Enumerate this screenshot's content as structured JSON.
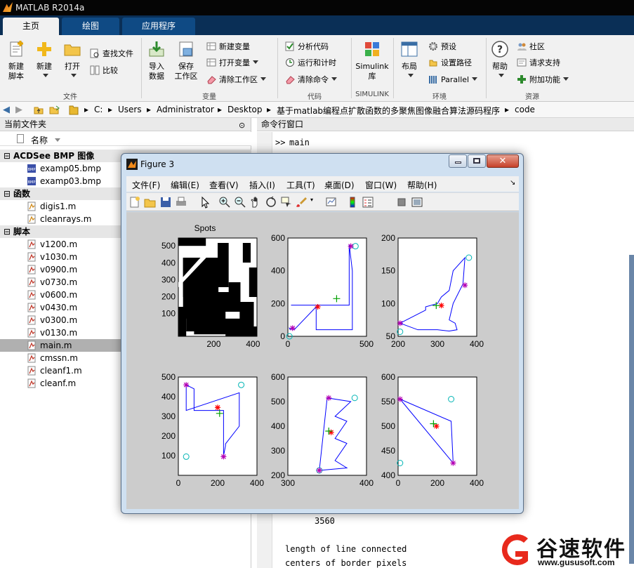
{
  "window": {
    "title": "MATLAB R2014a"
  },
  "tabs": [
    {
      "label": "主页"
    },
    {
      "label": "绘图"
    },
    {
      "label": "应用程序"
    }
  ],
  "ribbon": {
    "new_script": "新建\n脚本",
    "new": "新建",
    "open": "打开",
    "find_files": "查找文件",
    "compare": "比较",
    "group_file": "文件",
    "import": "导入\n数据",
    "save_ws": "保存\n工作区",
    "new_var": "新建变量",
    "open_var": "打开变量",
    "clear_ws": "清除工作区",
    "group_var": "变量",
    "analyze": "分析代码",
    "run_time": "运行和计时",
    "clear_cmd": "清除命令",
    "group_code": "代码",
    "simulink": "Simulink\n库",
    "group_simulink": "SIMULINK",
    "layout": "布局",
    "prefs": "预设",
    "set_path": "设置路径",
    "parallel": "Parallel",
    "group_env": "环境",
    "help": "帮助",
    "community": "社区",
    "support": "请求支持",
    "addons": "附加功能",
    "group_res": "资源"
  },
  "address": {
    "path": [
      "C:",
      "Users",
      "Administrator",
      "Desktop",
      "基于matlab编程点扩散函数的多聚焦图像融合算法源码程序",
      "code"
    ]
  },
  "left_panel": {
    "title": "当前文件夹",
    "column": "名称",
    "sections": [
      {
        "name": "ACDSee BMP 图像",
        "files": [
          "examp05.bmp",
          "examp03.bmp"
        ]
      },
      {
        "name": "函数",
        "files": [
          "digis1.m",
          "cleanrays.m"
        ]
      },
      {
        "name": "脚本",
        "files": [
          "v1200.m",
          "v1030.m",
          "v0900.m",
          "v0730.m",
          "v0600.m",
          "v0430.m",
          "v0300.m",
          "v0130.m",
          "main.m",
          "cmssn.m",
          "cleanf1.m",
          "cleanf.m"
        ]
      }
    ],
    "selected": "main.m"
  },
  "command_window": {
    "title": "命令行窗口",
    "prompt": ">>",
    "first_line": "main",
    "value_line": "3560",
    "text1": "length of line connected",
    "text2": "centers of border pixels"
  },
  "figure": {
    "title": "Figure 3",
    "menu": [
      "文件(F)",
      "编辑(E)",
      "查看(V)",
      "插入(I)",
      "工具(T)",
      "桌面(D)",
      "窗口(W)",
      "帮助(H)"
    ]
  },
  "chart_data": [
    {
      "type": "image",
      "title": "Spots",
      "x_ticks": [
        "200",
        "400"
      ],
      "y_ticks": [
        "500",
        "400",
        "300",
        "200",
        "100"
      ]
    },
    {
      "type": "line",
      "x_ticks": [
        "0",
        "500"
      ],
      "y_ticks": [
        "600",
        "400",
        "200",
        "0"
      ],
      "xlim": [
        0,
        500
      ],
      "ylim": [
        0,
        600
      ],
      "x": [
        15,
        10,
        40,
        180,
        180,
        410,
        410,
        390,
        390,
        20
      ],
      "y": [
        40,
        50,
        40,
        180,
        40,
        40,
        400,
        560,
        190,
        190
      ],
      "stars": [
        [
          30,
          50
        ],
        [
          400,
          550
        ]
      ],
      "circles": [
        [
          10,
          0
        ],
        [
          430,
          550
        ]
      ],
      "red_plus": [
        [
          190,
          180
        ]
      ],
      "green_plus": [
        [
          310,
          230
        ]
      ]
    },
    {
      "type": "line",
      "x_ticks": [
        "200",
        "300",
        "400"
      ],
      "y_ticks": [
        "200",
        "150",
        "100",
        "50"
      ],
      "xlim": [
        200,
        400
      ],
      "ylim": [
        50,
        200
      ],
      "x": [
        205,
        270,
        270,
        300,
        310,
        330,
        340,
        370,
        365,
        340,
        330,
        345,
        350,
        330,
        300,
        250,
        205
      ],
      "y": [
        70,
        90,
        95,
        100,
        110,
        120,
        150,
        170,
        130,
        100,
        75,
        70,
        60,
        58,
        60,
        60,
        70
      ],
      "stars": [
        [
          205,
          70
        ],
        [
          370,
          128
        ]
      ],
      "circles": [
        [
          205,
          57
        ],
        [
          380,
          170
        ]
      ],
      "red_plus": [
        [
          310,
          97
        ]
      ],
      "green_plus": [
        [
          297,
          97
        ]
      ]
    },
    {
      "type": "line",
      "x_ticks": [
        "0",
        "200",
        "400"
      ],
      "y_ticks": [
        "500",
        "400",
        "300",
        "200",
        "100"
      ],
      "xlim": [
        0,
        400
      ],
      "ylim": [
        0,
        500
      ],
      "x": [
        40,
        40,
        310,
        310,
        240,
        240,
        230,
        230,
        230,
        80,
        80,
        40
      ],
      "y": [
        460,
        330,
        420,
        250,
        160,
        150,
        100,
        100,
        330,
        330,
        440,
        460
      ],
      "stars": [
        [
          40,
          460
        ],
        [
          230,
          95
        ]
      ],
      "circles": [
        [
          320,
          460
        ],
        [
          40,
          95
        ]
      ],
      "red_plus": [
        [
          200,
          345
        ]
      ],
      "green_plus": [
        [
          210,
          315
        ]
      ]
    },
    {
      "type": "line",
      "x_ticks": [
        "300",
        "400"
      ],
      "y_ticks": [
        "600",
        "500",
        "400",
        "300",
        "200"
      ],
      "xlim": [
        300,
        400
      ],
      "ylim": [
        200,
        600
      ],
      "x": [
        340,
        350,
        380,
        360,
        375,
        360,
        375,
        360,
        375,
        340
      ],
      "y": [
        220,
        515,
        500,
        440,
        420,
        350,
        330,
        260,
        230,
        220
      ],
      "stars": [
        [
          352,
          515
        ],
        [
          340,
          220
        ]
      ],
      "circles": [
        [
          385,
          515
        ],
        [
          340,
          220
        ]
      ],
      "red_plus": [
        [
          355,
          375
        ]
      ],
      "green_plus": [
        [
          352,
          380
        ]
      ]
    },
    {
      "type": "line",
      "x_ticks": [
        "0",
        "200",
        "400"
      ],
      "y_ticks": [
        "600",
        "550",
        "500",
        "450",
        "400"
      ],
      "xlim": [
        0,
        400
      ],
      "ylim": [
        400,
        600
      ],
      "x": [
        10,
        270,
        280,
        10
      ],
      "y": [
        555,
        510,
        425,
        555
      ],
      "stars": [
        [
          10,
          555
        ],
        [
          280,
          425
        ]
      ],
      "circles": [
        [
          270,
          555
        ],
        [
          10,
          425
        ]
      ],
      "red_plus": [
        [
          195,
          500
        ]
      ],
      "green_plus": [
        [
          180,
          505
        ]
      ]
    }
  ],
  "watermark": {
    "brand": "谷速软件",
    "url": "www.gususoft.com"
  },
  "colors": {
    "series": "#0000ff",
    "star": "#b400b4",
    "circle": "#00b4b4",
    "red": "#ff0000",
    "green": "#00a000"
  }
}
